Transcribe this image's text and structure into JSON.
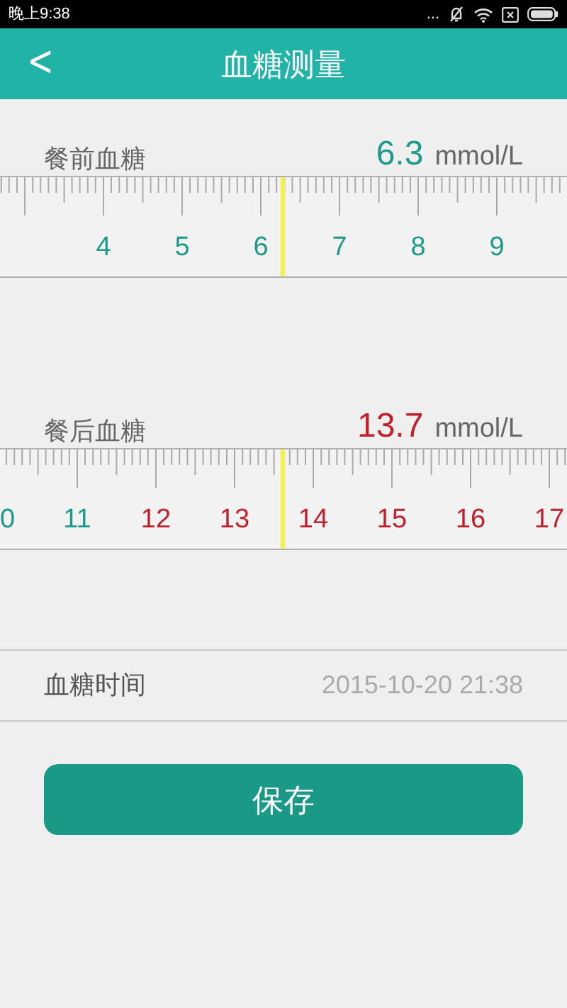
{
  "status_bar": {
    "time": "晚上9:38",
    "dots": "..."
  },
  "header": {
    "back": "<",
    "title": "血糖测量"
  },
  "rulers": [
    {
      "label": "餐前血糖",
      "reading": "6.3",
      "color": "#1e9a8a",
      "unit": "mmol/L",
      "ticks": [
        {
          "text": "4",
          "color": "#1e9a8a"
        },
        {
          "text": "5",
          "color": "#1e9a8a"
        },
        {
          "text": "6",
          "color": "#1e9a8a"
        },
        {
          "text": "7",
          "color": "#1e9a8a"
        },
        {
          "text": "8",
          "color": "#1e9a8a"
        },
        {
          "text": "9",
          "color": "#1e9a8a"
        }
      ]
    },
    {
      "label": "餐后血糖",
      "reading": "13.7",
      "color": "#c0202a",
      "unit": "mmol/L",
      "ticks": [
        {
          "text": "0",
          "color": "#1e9a8a"
        },
        {
          "text": "11",
          "color": "#1e9a8a"
        },
        {
          "text": "12",
          "color": "#c0202a"
        },
        {
          "text": "13",
          "color": "#c0202a"
        },
        {
          "text": "14",
          "color": "#c0202a"
        },
        {
          "text": "15",
          "color": "#c0202a"
        },
        {
          "text": "16",
          "color": "#c0202a"
        },
        {
          "text": "17",
          "color": "#c0202a"
        }
      ]
    }
  ],
  "time_row": {
    "label": "血糖时间",
    "value": "2015-10-20 21:38"
  },
  "save_button": "保存"
}
